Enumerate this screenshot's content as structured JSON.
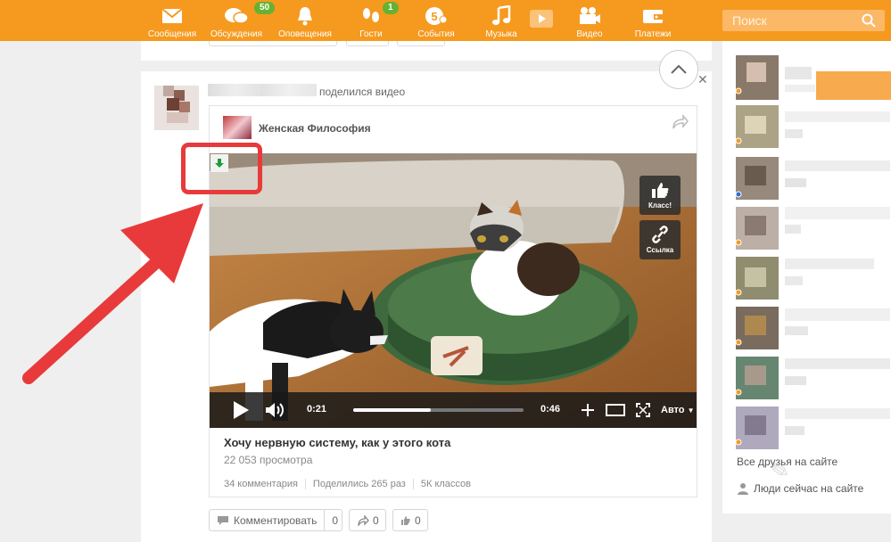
{
  "colors": {
    "brand_orange": "#f59a1f",
    "badge_green": "#65b232",
    "annotation_red": "#e83a3a"
  },
  "nav": [
    {
      "label": "Сообщения",
      "icon": "envelope-icon"
    },
    {
      "label": "Обсуждения",
      "icon": "chat-bubbles-icon",
      "badge": "50"
    },
    {
      "label": "Оповещения",
      "icon": "bell-icon"
    },
    {
      "label": "Гости",
      "icon": "footprints-icon",
      "badge": "1"
    },
    {
      "label": "События",
      "icon": "events-icon"
    },
    {
      "label": "Музыка",
      "icon": "music-note-icon"
    },
    {
      "label": "Видео",
      "icon": "video-camera-icon"
    },
    {
      "label": "Платежи",
      "icon": "wallet-icon"
    }
  ],
  "search": {
    "placeholder": "Поиск"
  },
  "post": {
    "action_text": "поделился видео",
    "group_name": "Женская Философия",
    "video": {
      "current_time": "0:21",
      "duration": "0:46",
      "progress_fraction": 0.457,
      "quality": "Авто",
      "class_label": "Класс!",
      "link_label": "Ссылка"
    },
    "title": "Хочу нервную систему, как у этого кота",
    "views": "22 053 просмотра",
    "stats": [
      "34 комментария",
      "Поделились 265 раз",
      "5К классов"
    ],
    "actions": {
      "comment_label": "Комментировать",
      "comment_count": "0",
      "share_count": "0",
      "like_count": "0"
    }
  },
  "sidebar": {
    "all_friends": "Все друзья на сайте",
    "now_online": "Люди сейчас на сайте"
  }
}
